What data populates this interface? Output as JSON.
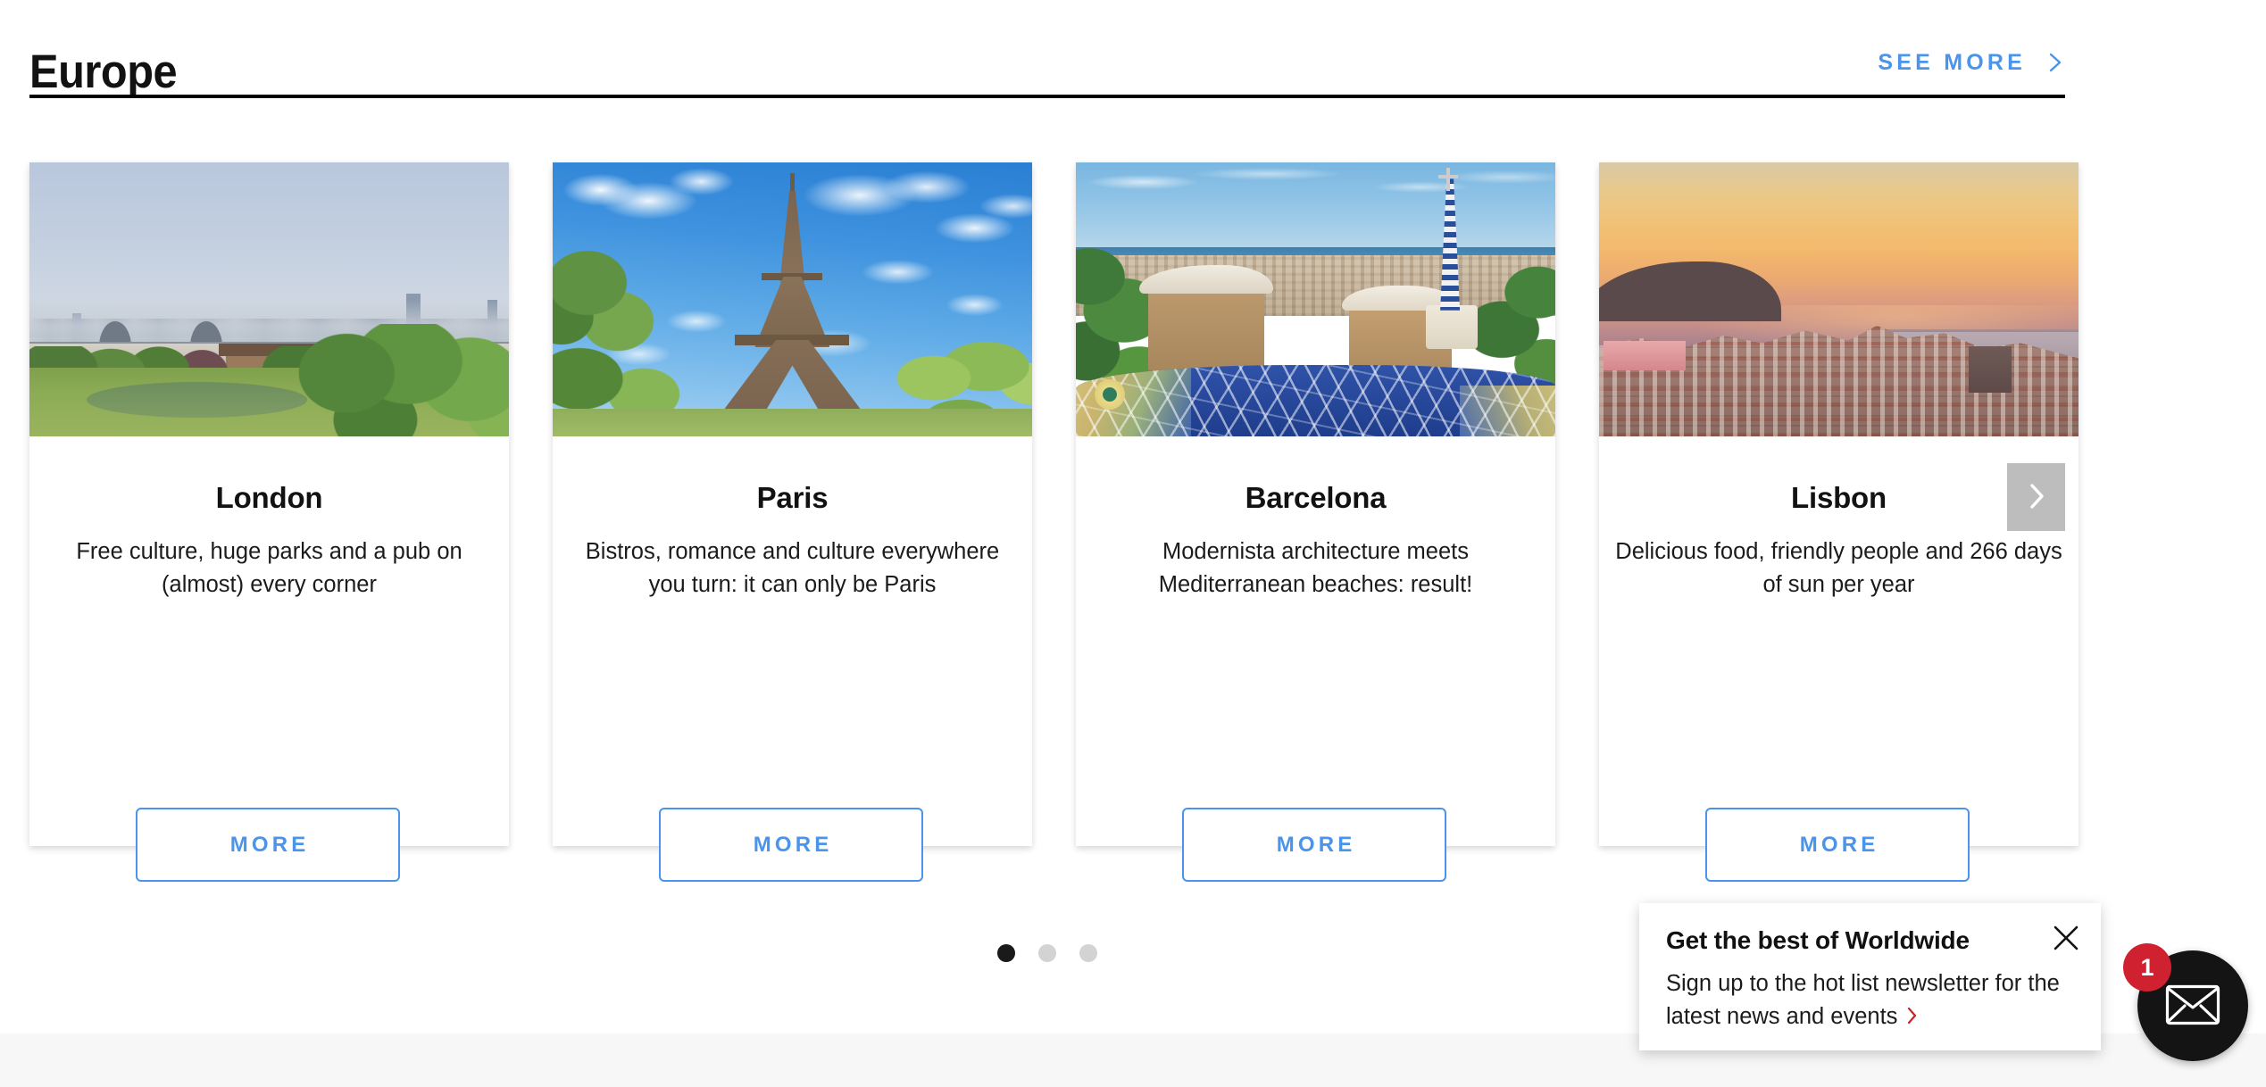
{
  "header": {
    "title": "Europe",
    "see_more_label": "SEE MORE",
    "see_more_icon": "chevron-right-icon",
    "accent_color": "#4a94eb",
    "rule_color": "#000000"
  },
  "carousel": {
    "next_label": "chevron-right-icon",
    "dots": [
      {
        "active": true
      },
      {
        "active": false
      },
      {
        "active": false
      }
    ],
    "cards": [
      {
        "city": "London",
        "description": "Free culture, huge parks and a pub on (almost) every corner",
        "more_label": "MORE",
        "image_alt": "london-skyline-greenwich-park-photo"
      },
      {
        "city": "Paris",
        "description": "Bistros, romance and culture everywhere you turn: it can only be Paris",
        "more_label": "MORE",
        "image_alt": "paris-eiffel-tower-photo"
      },
      {
        "city": "Barcelona",
        "description": "Modernista architecture meets Mediterranean beaches: result!",
        "more_label": "MORE",
        "image_alt": "barcelona-park-guell-photo"
      },
      {
        "city": "Lisbon",
        "description": "Delicious food, friendly people and 266 days of sun per year",
        "more_label": "MORE",
        "image_alt": "lisbon-sunset-skyline-photo"
      }
    ]
  },
  "newsletter_popup": {
    "title": "Get the best of Worldwide",
    "body": "Sign up to the hot list newsletter for the latest news and events",
    "arrow_icon": "chevron-right-icon",
    "arrow_color": "#cc2222",
    "close_icon": "close-icon"
  },
  "mail_widget": {
    "icon": "envelope-icon",
    "badge_count": "1",
    "badge_color": "#cf2130",
    "button_color": "#141414"
  }
}
